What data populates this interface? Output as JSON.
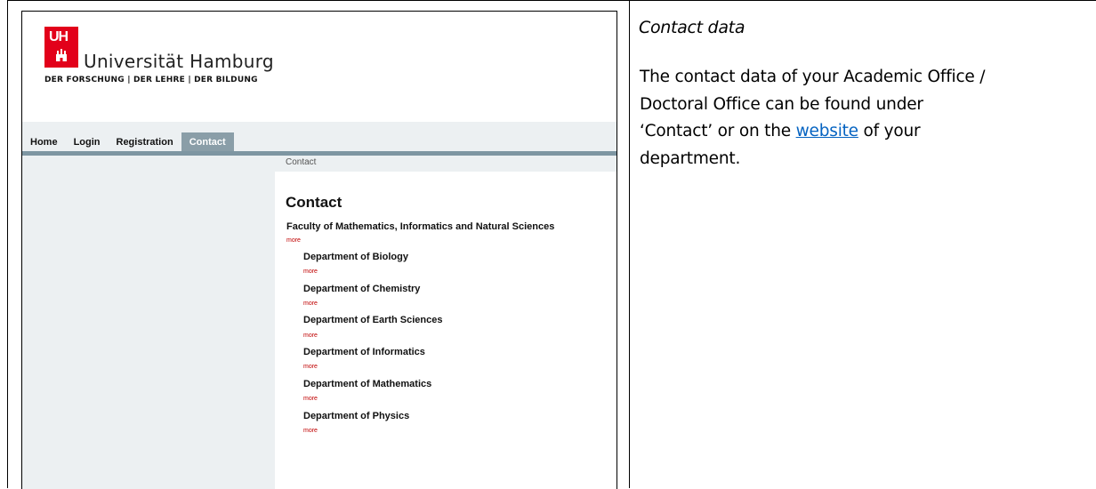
{
  "screenshot": {
    "logo": {
      "mark_text": "UH",
      "name": "Universität Hamburg",
      "tagline": "DER FORSCHUNG | DER LEHRE | DER BILDUNG",
      "brand_color": "#e2001a"
    },
    "nav": [
      {
        "label": "Home"
      },
      {
        "label": "Login"
      },
      {
        "label": "Registration"
      },
      {
        "label": "Contact"
      }
    ],
    "breadcrumb": "Contact",
    "title": "Contact",
    "faculty": {
      "name": "Faculty of Mathematics, Informatics and Natural Sciences",
      "more": "more"
    },
    "departments": [
      {
        "name": "Department of Biology",
        "more": "more"
      },
      {
        "name": "Department of Chemistry",
        "more": "more"
      },
      {
        "name": "Department of Earth Sciences",
        "more": "more"
      },
      {
        "name": "Department of Informatics",
        "more": "more"
      },
      {
        "name": "Department of Mathematics",
        "more": "more"
      },
      {
        "name": "Department of Physics",
        "more": "more"
      }
    ]
  },
  "description": {
    "heading": "Contact data",
    "line1": "The contact data of your Academic Office /",
    "line2": "Doctoral Office can be found under",
    "line3_before": "‘Contact’ or on the ",
    "link": "website",
    "line3_after": " of your",
    "line4": "department."
  }
}
